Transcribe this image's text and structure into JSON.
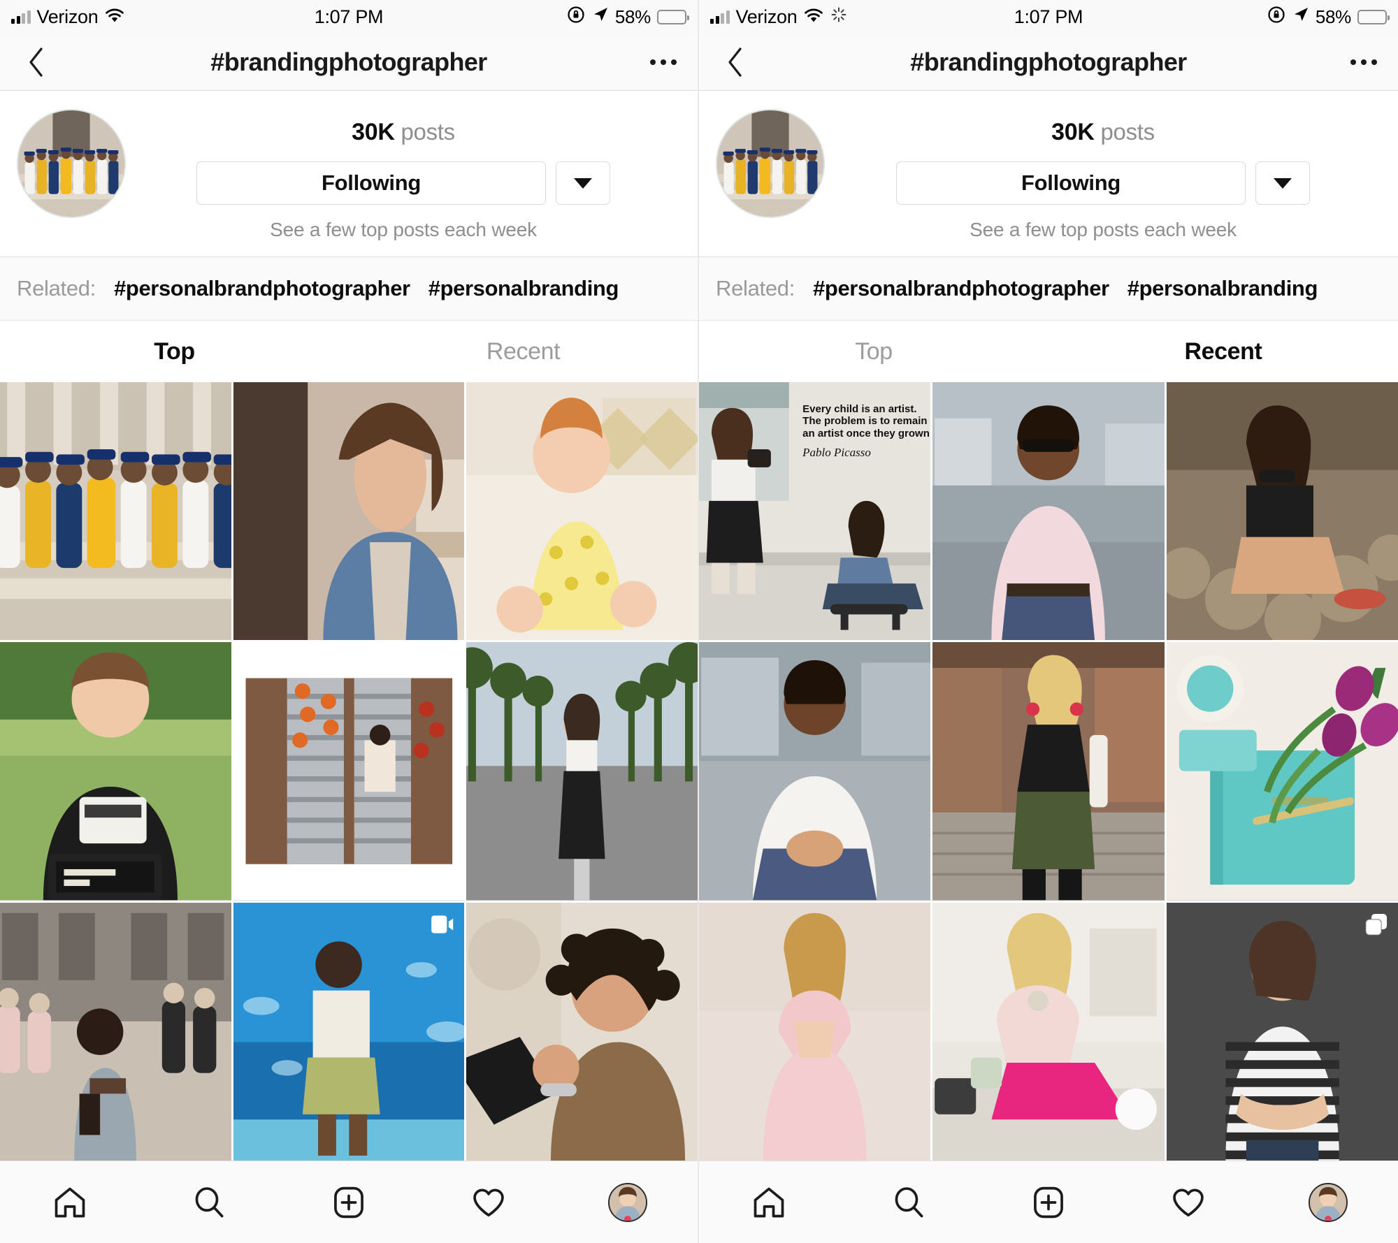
{
  "panels": [
    {
      "id": "left",
      "status": {
        "carrier": "Verizon",
        "time": "1:07 PM",
        "battery_pct": "58%",
        "icons": [
          "signal-bars-icon",
          "wifi-icon",
          "rotation-lock-icon",
          "location-arrow-icon",
          "battery-icon"
        ],
        "spinner": false
      },
      "nav": {
        "back_icon": "chevron-left-icon",
        "title": "#brandingphotographer",
        "more_icon": "more-options-icon"
      },
      "profile": {
        "avatar_icon": "hashtag-avatar",
        "posts_count": "30K",
        "posts_label": "posts",
        "follow_label": "Following",
        "chevron_icon": "chevron-down-icon",
        "subtitle": "See a few top posts each week"
      },
      "related": {
        "label": "Related:",
        "tags": [
          "#personalbrandphotographer",
          "#personalbranding"
        ]
      },
      "tabs": [
        {
          "label": "Top",
          "active": true
        },
        {
          "label": "Recent",
          "active": false
        }
      ],
      "grid": [
        {
          "name": "grid-photo-graduates-on-steps",
          "badge": null
        },
        {
          "name": "grid-photo-woman-denim-jacket",
          "badge": null
        },
        {
          "name": "grid-photo-baby-laughing-on-bed",
          "badge": null
        },
        {
          "name": "grid-photo-boy-with-letterboard",
          "badge": null
        },
        {
          "name": "grid-photo-escalator-overhead",
          "badge": null
        },
        {
          "name": "grid-photo-woman-palm-tree-street",
          "badge": null
        },
        {
          "name": "grid-photo-bride-back-view",
          "badge": null
        },
        {
          "name": "grid-photo-woman-at-aquarium",
          "badge": "video-icon"
        },
        {
          "name": "grid-photo-woman-laughing-curly-hair",
          "badge": null
        }
      ]
    },
    {
      "id": "right",
      "status": {
        "carrier": "Verizon",
        "time": "1:07 PM",
        "battery_pct": "58%",
        "icons": [
          "signal-bars-icon",
          "wifi-icon",
          "loading-spinner-icon",
          "rotation-lock-icon",
          "location-arrow-icon",
          "battery-icon"
        ],
        "spinner": true
      },
      "nav": {
        "back_icon": "chevron-left-icon",
        "title": "#brandingphotographer",
        "more_icon": "more-options-icon"
      },
      "profile": {
        "avatar_icon": "hashtag-avatar",
        "posts_count": "30K",
        "posts_label": "posts",
        "follow_label": "Following",
        "chevron_icon": "chevron-down-icon",
        "subtitle": "See a few top posts each week"
      },
      "related": {
        "label": "Related:",
        "tags": [
          "#personalbrandphotographer",
          "#personalbranding"
        ]
      },
      "tabs": [
        {
          "label": "Top",
          "active": false
        },
        {
          "label": "Recent",
          "active": true
        }
      ],
      "grid": [
        {
          "name": "grid-photo-picasso-quote-photoshoot",
          "badge": null,
          "overlay": {
            "line1": "Every child is an artist.",
            "line2": "The problem is to remain",
            "line3": "an artist once they grown up.",
            "signature": "Pablo Picasso"
          }
        },
        {
          "name": "grid-photo-man-sunglasses-pink-shirt",
          "badge": null
        },
        {
          "name": "grid-photo-woman-sitting-on-rocks",
          "badge": null
        },
        {
          "name": "grid-photo-man-white-shirt-seated",
          "badge": null
        },
        {
          "name": "grid-photo-woman-alley-black-dress",
          "badge": null
        },
        {
          "name": "grid-photo-tulips-planner-flatlay",
          "badge": null
        },
        {
          "name": "grid-photo-woman-pink-gown",
          "badge": null
        },
        {
          "name": "grid-photo-woman-laughing-pink-pants",
          "badge": null
        },
        {
          "name": "grid-photo-woman-striped-shirt-gray",
          "badge": "carousel-icon"
        }
      ]
    }
  ],
  "tabbar": {
    "items": [
      {
        "name": "home-icon",
        "label": "Home"
      },
      {
        "name": "search-icon",
        "label": "Search"
      },
      {
        "name": "add-post-icon",
        "label": "Add"
      },
      {
        "name": "activity-heart-icon",
        "label": "Activity"
      },
      {
        "name": "profile-avatar-icon",
        "label": "Profile"
      }
    ],
    "has_notification_dot": true
  },
  "colors": {
    "accent_red": "#e8405a",
    "text_primary": "#0d0d0d",
    "text_secondary": "#8e8e8e",
    "border": "#dbdbdb",
    "bar_bg": "#fafafa"
  }
}
